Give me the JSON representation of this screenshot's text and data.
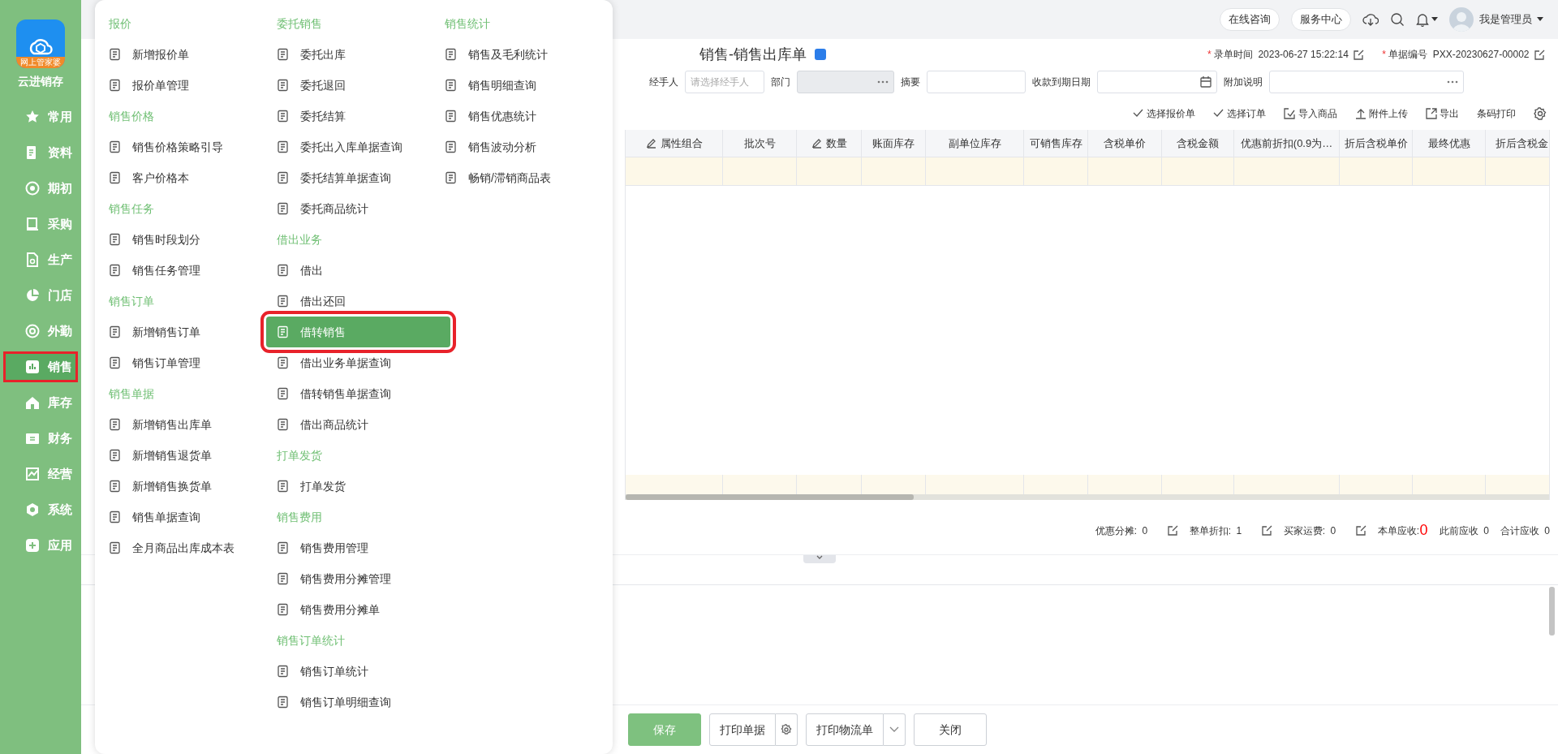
{
  "app": {
    "logo_badge": "网上管家婆",
    "name": "云进销存"
  },
  "sidebar": {
    "items": [
      {
        "label": "常用",
        "selected": false
      },
      {
        "label": "资料",
        "selected": false
      },
      {
        "label": "期初",
        "selected": false
      },
      {
        "label": "采购",
        "selected": false
      },
      {
        "label": "生产",
        "selected": false
      },
      {
        "label": "门店",
        "selected": false
      },
      {
        "label": "外勤",
        "selected": false
      },
      {
        "label": "销售",
        "selected": true
      },
      {
        "label": "库存",
        "selected": false
      },
      {
        "label": "财务",
        "selected": false
      },
      {
        "label": "经营",
        "selected": false
      },
      {
        "label": "系统",
        "selected": false
      },
      {
        "label": "应用",
        "selected": false
      }
    ]
  },
  "topbar": {
    "links": [
      "在线咨询",
      "服务中心"
    ],
    "user": "我是管理员"
  },
  "menu": {
    "columns": [
      {
        "groups": [
          {
            "title": "报价",
            "items": [
              {
                "label": "新增报价单",
                "selected": false
              },
              {
                "label": "报价单管理",
                "selected": false
              }
            ]
          },
          {
            "title": "销售价格",
            "items": [
              {
                "label": "销售价格策略引导",
                "selected": false
              },
              {
                "label": "客户价格本",
                "selected": false
              }
            ]
          },
          {
            "title": "销售任务",
            "items": [
              {
                "label": "销售时段划分",
                "selected": false
              },
              {
                "label": "销售任务管理",
                "selected": false
              }
            ]
          },
          {
            "title": "销售订单",
            "items": [
              {
                "label": "新增销售订单",
                "selected": false
              },
              {
                "label": "销售订单管理",
                "selected": false
              }
            ]
          },
          {
            "title": "销售单据",
            "items": [
              {
                "label": "新增销售出库单",
                "selected": false
              },
              {
                "label": "新增销售退货单",
                "selected": false
              },
              {
                "label": "新增销售换货单",
                "selected": false
              },
              {
                "label": "销售单据查询",
                "selected": false
              },
              {
                "label": "全月商品出库成本表",
                "selected": false
              }
            ]
          }
        ]
      },
      {
        "groups": [
          {
            "title": "委托销售",
            "items": [
              {
                "label": "委托出库",
                "selected": false
              },
              {
                "label": "委托退回",
                "selected": false
              },
              {
                "label": "委托结算",
                "selected": false
              },
              {
                "label": "委托出入库单据查询",
                "selected": false
              },
              {
                "label": "委托结算单据查询",
                "selected": false
              },
              {
                "label": "委托商品统计",
                "selected": false
              }
            ]
          },
          {
            "title": "借出业务",
            "items": [
              {
                "label": "借出",
                "selected": false
              },
              {
                "label": "借出还回",
                "selected": false
              },
              {
                "label": "借转销售",
                "selected": true
              },
              {
                "label": "借出业务单据查询",
                "selected": false
              },
              {
                "label": "借转销售单据查询",
                "selected": false
              },
              {
                "label": "借出商品统计",
                "selected": false
              }
            ]
          },
          {
            "title": "打单发货",
            "items": [
              {
                "label": "打单发货",
                "selected": false
              }
            ]
          },
          {
            "title": "销售费用",
            "items": [
              {
                "label": "销售费用管理",
                "selected": false
              },
              {
                "label": "销售费用分摊管理",
                "selected": false
              },
              {
                "label": "销售费用分摊单",
                "selected": false
              }
            ]
          },
          {
            "title": "销售订单统计",
            "items": [
              {
                "label": "销售订单统计",
                "selected": false
              },
              {
                "label": "销售订单明细查询",
                "selected": false
              }
            ]
          }
        ]
      },
      {
        "groups": [
          {
            "title": "销售统计",
            "items": [
              {
                "label": "销售及毛利统计",
                "selected": false
              },
              {
                "label": "销售明细查询",
                "selected": false
              },
              {
                "label": "销售优惠统计",
                "selected": false
              },
              {
                "label": "销售波动分析",
                "selected": false
              },
              {
                "label": "畅销/滞销商品表",
                "selected": false
              }
            ]
          }
        ]
      }
    ]
  },
  "document": {
    "title": "销售-销售出库单",
    "meta": [
      {
        "required_mark": "*",
        "label": "录单时间",
        "value": "2023-06-27 15:22:14"
      },
      {
        "required_mark": "*",
        "label": "单据编号",
        "value": "PXX-20230627-00002"
      }
    ],
    "fields": [
      {
        "label": "经手人",
        "kind": "text",
        "placeholder": "请选择经手人",
        "disabled": false
      },
      {
        "label": "部门",
        "kind": "picker",
        "disabled": true
      },
      {
        "label": "摘要",
        "kind": "text",
        "disabled": false
      },
      {
        "label": "收款到期日期",
        "kind": "date",
        "disabled": false
      },
      {
        "label": "附加说明",
        "kind": "picker",
        "disabled": false
      }
    ],
    "toolbar": [
      {
        "label": "选择报价单",
        "kind": "check"
      },
      {
        "label": "选择订单",
        "kind": "check"
      },
      {
        "label": "导入商品",
        "kind": "import"
      },
      {
        "label": "附件上传",
        "kind": "upload"
      },
      {
        "label": "导出",
        "kind": "export"
      },
      {
        "label": "条码打印",
        "kind": "plain"
      }
    ],
    "table": {
      "columns": [
        {
          "label": "属性组合",
          "editable": true
        },
        {
          "label": "批次号",
          "editable": false
        },
        {
          "label": "数量",
          "editable": true
        },
        {
          "label": "账面库存",
          "editable": false
        },
        {
          "label": "副单位库存",
          "editable": false
        },
        {
          "label": "可销售库存",
          "editable": false
        },
        {
          "label": "含税单价",
          "editable": false
        },
        {
          "label": "含税金额",
          "editable": false
        },
        {
          "label": "优惠前折扣(0.9为…",
          "editable": false
        },
        {
          "label": "折后含税单价",
          "editable": false
        },
        {
          "label": "最终优惠",
          "editable": false
        },
        {
          "label": "折后含税金",
          "editable": false
        }
      ]
    },
    "totals": [
      {
        "label": "优惠分摊:",
        "value": "0",
        "kind": "editable"
      },
      {
        "label": "整单折扣:",
        "value": "1",
        "kind": "editable"
      },
      {
        "label": "买家运费:",
        "value": "0",
        "kind": "editable"
      },
      {
        "label": "本单应收:",
        "value": "0",
        "kind": "highlight"
      },
      {
        "label": "此前应收",
        "value": "0",
        "kind": "plain"
      },
      {
        "label": "合计应收",
        "value": "0",
        "kind": "plain"
      }
    ],
    "buttons": [
      {
        "label": "保存",
        "kind": "primary"
      },
      {
        "label": "打印单据",
        "kind": "split-gear"
      },
      {
        "label": "打印物流单",
        "kind": "split-caret"
      },
      {
        "label": "关闭",
        "kind": "plain"
      }
    ]
  }
}
